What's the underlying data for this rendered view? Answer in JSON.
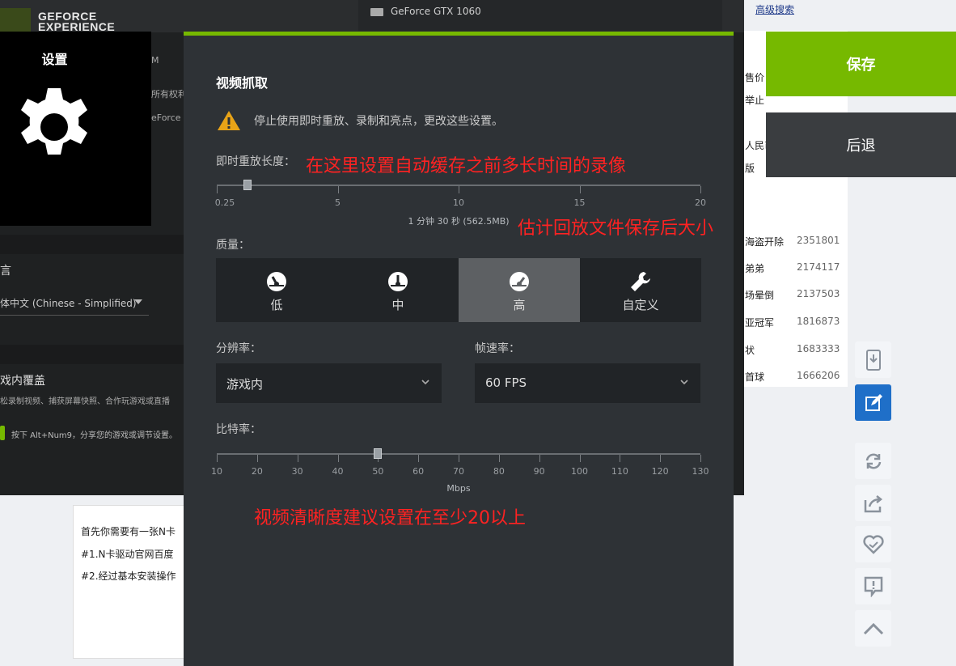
{
  "background": {
    "advanced_search": "高级搜索",
    "cut_texts": [
      "售价",
      "举止",
      "人民币",
      "版"
    ],
    "ranking": [
      {
        "title": "海盗开除",
        "count": "2351801"
      },
      {
        "title": "弟弟",
        "count": "2174117"
      },
      {
        "title": "场晕倒",
        "count": "2137503"
      },
      {
        "title": "亚冠军",
        "count": "1816873"
      },
      {
        "title": "状",
        "count": "1683333"
      },
      {
        "title": "首球",
        "count": "1666206"
      }
    ],
    "article_lines": [
      "首先你需要有一张N卡",
      "#1.N卡驱动官网百度",
      "#2.经过基本安装操作"
    ],
    "side_tools": [
      "phone-icon",
      "edit-icon",
      "refresh-icon",
      "share-icon",
      "heart-icon",
      "report-icon",
      "up-arrow-icon"
    ]
  },
  "gfe": {
    "logo_line1": "GEFORCE",
    "logo_line2": "EXPERIENCE",
    "gpu_name": "GeForce GTX 1060",
    "behind_texts": [
      "M",
      "所有权利。",
      "eForce E"
    ],
    "language_label": "言",
    "language_value": "体中文 (Chinese - Simplified)",
    "overlay_title": "戏内覆盖",
    "overlay_desc": "松录制视频、捕获屏幕快照、合作玩游戏或直播",
    "hint_text": "按下 Alt+Num9，分享您的游戏或调节设置。"
  },
  "settings_card": {
    "title": "设置",
    "icon": "gear-icon"
  },
  "modal": {
    "title": "视频抓取",
    "warning_text": "停止使用即时重放、录制和亮点，更改这些设置。",
    "replay_label": "即时重放长度：",
    "replay_ticks": [
      "0.25",
      "5",
      "10",
      "15",
      "20"
    ],
    "replay_value_minutes": 1.5,
    "replay_caption": "1 分钟 30 秒 (562.5MB)",
    "quality_label": "质量：",
    "quality_options": [
      {
        "label": "低",
        "icon": "gauge-low-icon"
      },
      {
        "label": "中",
        "icon": "gauge-mid-icon"
      },
      {
        "label": "高",
        "icon": "gauge-high-icon"
      },
      {
        "label": "自定义",
        "icon": "wrench-icon"
      }
    ],
    "quality_selected": "高",
    "resolution_label": "分辨率：",
    "resolution_value": "游戏内",
    "fps_label": "帧速率：",
    "fps_value": "60 FPS",
    "bitrate_label": "比特率：",
    "bitrate_ticks": [
      "10",
      "20",
      "30",
      "40",
      "50",
      "60",
      "70",
      "80",
      "90",
      "100",
      "110",
      "120",
      "130"
    ],
    "bitrate_value": 50,
    "bitrate_unit": "Mbps"
  },
  "annotations": {
    "replay": "在这里设置自动缓存之前多长时间的录像",
    "size": "估计回放文件保存后大小",
    "bitrate": "视频清晰度建议设置在至少20以上"
  },
  "actions": {
    "save": "保存",
    "back": "后退"
  },
  "colors": {
    "accent": "#76b900",
    "annotation": "#ff2222",
    "modal_bg": "#2e3236"
  }
}
